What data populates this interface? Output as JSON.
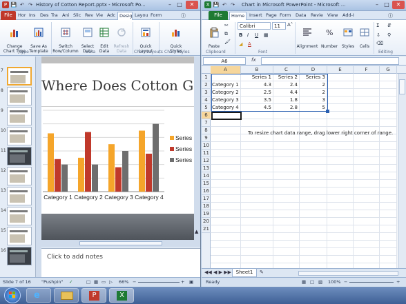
{
  "colors": {
    "ppt_file": "#c0392b",
    "xl_file": "#1e7a34",
    "series1": "#f5a52a",
    "series2": "#c0392b",
    "series3": "#6e6e6e",
    "range_border": "#2a5fb0",
    "selection": "#f0c36d"
  },
  "ppt": {
    "title": "History of Cotton Report.pptx - Microsoft Po...",
    "file_tab": "File",
    "tabs": [
      "Hor",
      "Ins",
      "Des",
      "Tra",
      "Ani",
      "Slic",
      "Rev",
      "Vie",
      "Adc",
      "Desig",
      "Layou",
      "Form"
    ],
    "groups": {
      "type": "Type",
      "data": "Data",
      "chart_layouts": "Chart Layouts",
      "chart_styles": "Chart Styles"
    },
    "buttons": {
      "change_chart_type": "Change\nChart Type",
      "save_as_template": "Save As\nTemplate",
      "switch_row_column": "Switch\nRow/Column",
      "select_data": "Select\nData",
      "edit_data": "Edit\nData",
      "refresh_data": "Refresh\nData",
      "quick_layout": "Quick\nLayout",
      "quick_styles": "Quick\nStyles"
    },
    "slide_numbers": [
      "7",
      "8",
      "9",
      "10",
      "11",
      "12",
      "13",
      "14",
      "15",
      "16"
    ],
    "slide_title": "Where Does Cotton Grov",
    "notes_placeholder": "Click to add notes",
    "status": {
      "slide": "Slide 7 of 16",
      "theme": "\"Pushpin\"",
      "zoom": "66%"
    }
  },
  "xl": {
    "title": "Chart in Microsoft PowerPoint - Microsoft ...",
    "file_tab": "File",
    "tabs": [
      "Home",
      "Insert",
      "Page",
      "Form",
      "Data",
      "Revie",
      "View",
      "Add-I"
    ],
    "font_name": "Calibri",
    "font_size": "11",
    "groups": {
      "clipboard": "Clipboard",
      "font": "Font",
      "alignment": "Alignment",
      "number": "Number",
      "styles": "Styles",
      "cells": "Cells",
      "editing": "Editing"
    },
    "paste_label": "Paste",
    "name_box": "A6",
    "fx": "fx",
    "columns": [
      "A",
      "B",
      "C",
      "D",
      "E",
      "F",
      "G"
    ],
    "rows": [
      "1",
      "2",
      "3",
      "4",
      "5",
      "6",
      "7",
      "8",
      "9",
      "10",
      "11",
      "12",
      "13",
      "14",
      "15",
      "16",
      "17",
      "18",
      "19",
      "20",
      "21"
    ],
    "headers": [
      "Series 1",
      "Series 2",
      "Series 3"
    ],
    "data_rows": [
      {
        "label": "Category 1",
        "values": [
          "4.3",
          "2.4",
          "2"
        ]
      },
      {
        "label": "Category 2",
        "values": [
          "2.5",
          "4.4",
          "2"
        ]
      },
      {
        "label": "Category 3",
        "values": [
          "3.5",
          "1.8",
          "3"
        ]
      },
      {
        "label": "Category 4",
        "values": [
          "4.5",
          "2.8",
          "5"
        ]
      }
    ],
    "hint": "To resize chart data range, drag lower right corner of range.",
    "sheet_tab": "Sheet1",
    "status_ready": "Ready",
    "zoom": "100%"
  },
  "chart_data": {
    "type": "bar",
    "categories": [
      "Category 1",
      "Category 2",
      "Category 3",
      "Category 4"
    ],
    "series": [
      {
        "name": "Series 1",
        "values": [
          4.3,
          2.5,
          3.5,
          4.5
        ]
      },
      {
        "name": "Series 2",
        "values": [
          2.4,
          4.4,
          1.8,
          2.8
        ]
      },
      {
        "name": "Series 3",
        "values": [
          2,
          2,
          3,
          5
        ]
      }
    ],
    "legend_labels": [
      "Series",
      "Series",
      "Series"
    ],
    "ylim": [
      0,
      6
    ],
    "grid": true,
    "legend": "right"
  }
}
